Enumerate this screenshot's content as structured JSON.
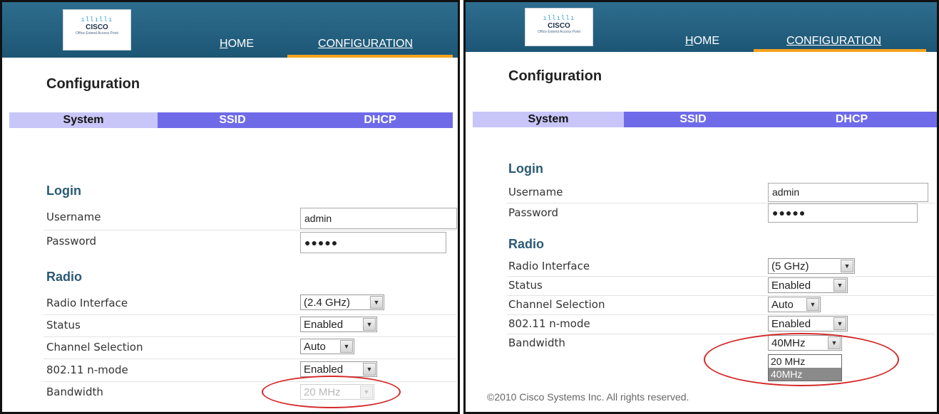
{
  "left": {
    "logo": {
      "bars": "ıllıllı",
      "brand": "CISCO",
      "sub": "Office Extend Access Point"
    },
    "nav": {
      "home_prefix": "H",
      "home_rest": "OME",
      "config_prefix": "C",
      "config_rest": "ONFIGURATION"
    },
    "page_title": "Configuration",
    "tabs": [
      "System",
      "SSID",
      "DHCP"
    ],
    "login": {
      "heading": "Login",
      "username_label": "Username",
      "username_value": "admin",
      "password_label": "Password",
      "password_value": "●●●●●"
    },
    "radio": {
      "heading": "Radio",
      "interface_label": "Radio Interface",
      "interface_value": "(2.4 GHz)",
      "status_label": "Status",
      "status_value": "Enabled",
      "channel_label": "Channel Selection",
      "channel_value": "Auto",
      "nmode_label": "802.11 n-mode",
      "nmode_value": "Enabled",
      "bandwidth_label": "Bandwidth",
      "bandwidth_value": "20 MHz"
    }
  },
  "right": {
    "logo": {
      "bars": "ıllıllı",
      "brand": "CISCO",
      "sub": "Office Extend Access Point"
    },
    "nav": {
      "home_prefix": "H",
      "home_rest": "OME",
      "config_prefix": "C",
      "config_rest": "ONFIGURATION"
    },
    "page_title": "Configuration",
    "tabs": [
      "System",
      "SSID",
      "DHCP"
    ],
    "login": {
      "heading": "Login",
      "username_label": "Username",
      "username_value": "admin",
      "password_label": "Password",
      "password_value": "●●●●●"
    },
    "radio": {
      "heading": "Radio",
      "interface_label": "Radio Interface",
      "interface_value": "(5 GHz)",
      "status_label": "Status",
      "status_value": "Enabled",
      "channel_label": "Channel Selection",
      "channel_value": "Auto",
      "nmode_label": "802.11 n-mode",
      "nmode_value": "Enabled",
      "bandwidth_label": "Bandwidth",
      "bandwidth_value": "40MHz",
      "bandwidth_options": [
        "20 MHz",
        "40MHz"
      ]
    },
    "footer": "©2010 Cisco Systems Inc. All rights reserved."
  },
  "colors": {
    "header": "#2e6d8e",
    "tab_active": "#c8c6f8",
    "tab_inactive": "#6f6be8",
    "nav_underline": "#f5a21e",
    "section_heading": "#2b5a75",
    "highlight_ellipse": "#d42828"
  },
  "icons": {
    "dropdown_arrow": "▼"
  }
}
